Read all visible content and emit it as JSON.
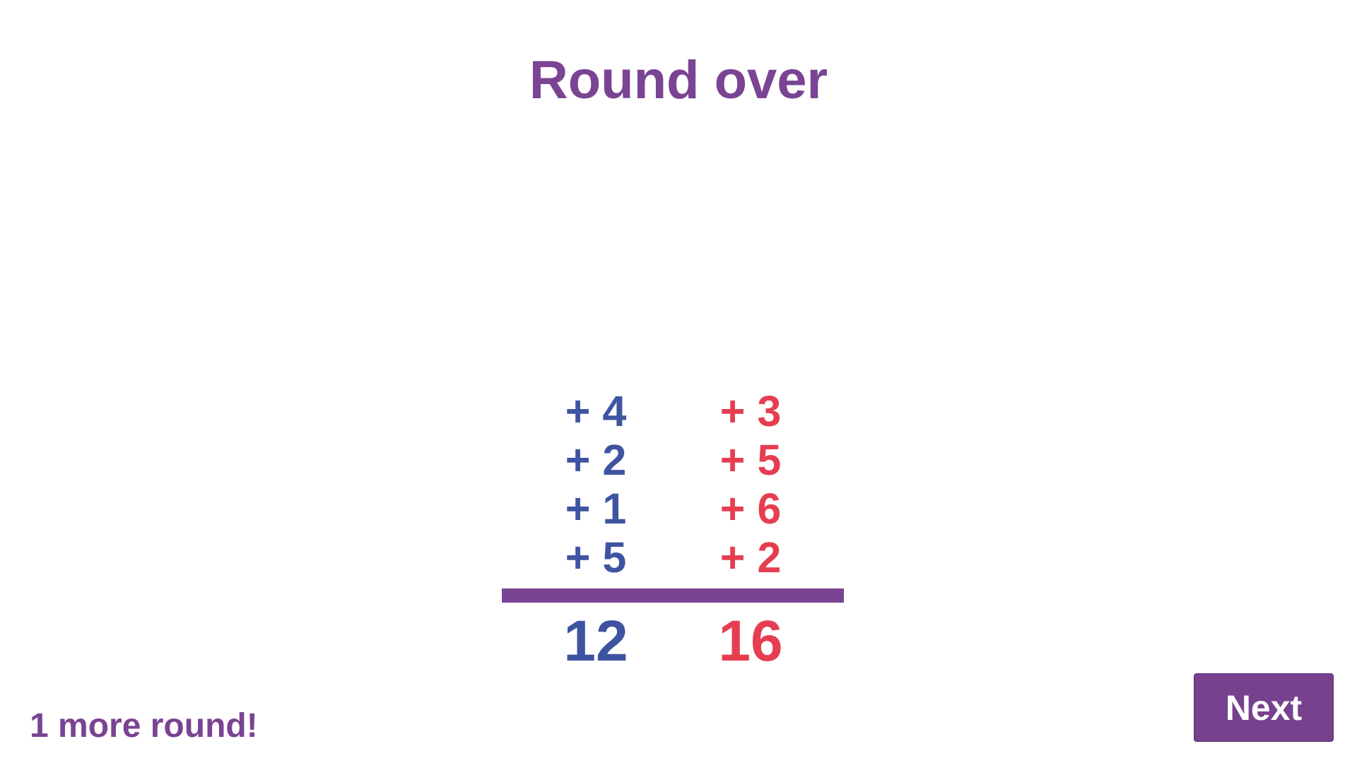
{
  "title": "Round over",
  "players": [
    {
      "color": "#3f54a0",
      "addends": [
        "+ 4",
        "+ 2",
        "+ 1",
        "+ 5"
      ],
      "total": "12"
    },
    {
      "color": "#e63e50",
      "addends": [
        "+ 3",
        "+ 5",
        "+ 6",
        "+ 2"
      ],
      "total": "16"
    }
  ],
  "rounds_remaining": "1 more round!",
  "next_label": "Next",
  "accent": "#7a4393"
}
